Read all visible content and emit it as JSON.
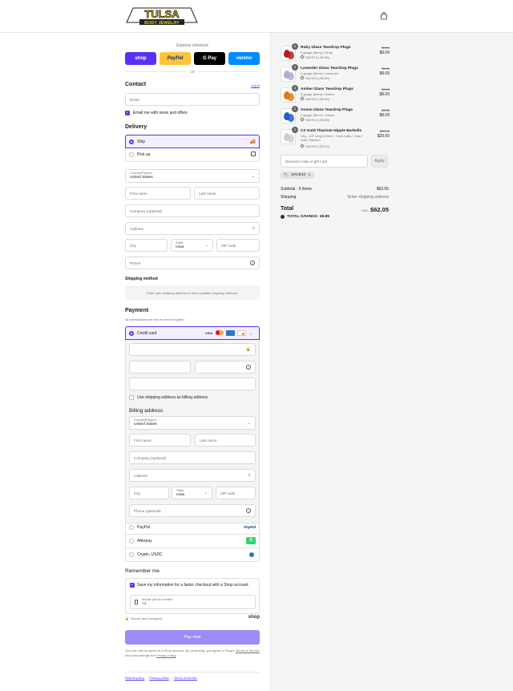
{
  "header": {
    "brand_main": "TULSA",
    "brand_sub": "BODY JEWELRY"
  },
  "express": {
    "title": "Express checkout",
    "buttons": [
      {
        "label": "shop",
        "color": "#5a31f4"
      },
      {
        "label": "PayPal",
        "color": "#ffc439"
      },
      {
        "label": "G Pay",
        "color": "#000000"
      },
      {
        "label": "venmo",
        "color": "#008cff"
      }
    ],
    "or": "OR"
  },
  "contact": {
    "heading": "Contact",
    "login": "Log in",
    "email_placeholder": "Email",
    "news_label": "Email me with news and offers"
  },
  "delivery": {
    "heading": "Delivery",
    "ship": "Ship",
    "pickup": "Pick up",
    "country_label": "Country/Region",
    "country_value": "United States",
    "first_name": "First name",
    "last_name": "Last name",
    "company": "Company (optional)",
    "address": "Address",
    "city": "City",
    "state_label": "State",
    "state_value": "Iowa",
    "zip": "ZIP code",
    "phone": "Phone"
  },
  "shipping_method": {
    "heading": "Shipping method",
    "note": "Enter your shipping address to view available shipping methods."
  },
  "payment": {
    "heading": "Payment",
    "subtitle": "All transactions are secure and encrypted.",
    "credit_card": "Credit card",
    "more_cards": "→",
    "use_shipping": "Use shipping address as billing address",
    "billing_heading": "Billing address",
    "billing": {
      "country_label": "Country/Region",
      "country_value": "United States",
      "first_name": "First name",
      "last_name": "Last name",
      "company": "Company (optional)",
      "address": "Address",
      "city": "City",
      "state_label": "State",
      "state_value": "Iowa",
      "zip": "ZIP code",
      "phone": "Phone (optional)"
    },
    "paypal": "PayPal",
    "paypal_logo": "PayPal",
    "afterpay": "Afterpay",
    "afterpay_logo": "$",
    "crypto": "Crypto, USDC"
  },
  "remember": {
    "heading": "Remember me",
    "save_label": "Save my information for a faster checkout with a Shop account",
    "mobile_label": "Mobile phone number",
    "mobile_value": "+1",
    "secure": "Secure and encrypted",
    "shop_logo": "shop"
  },
  "pay_now": "Pay now",
  "legal": {
    "text1": "Your info will be saved to a Shop account. By continuing, you agree to Shop's",
    "terms": "Terms of Service",
    "text2": "and acknowledge the",
    "privacy": "Privacy Policy",
    "text3": "."
  },
  "footer_links": [
    "Refund policy",
    "Privacy policy",
    "Terms of service"
  ],
  "cart": {
    "items": [
      {
        "title": "Ruby Glass Teardrop Plugs",
        "variant": "0 gauge (8mm) / Ruby",
        "discount": "SAVE10 (-$0.89)",
        "old_price": "$8.98",
        "price": "$8.09",
        "qty": "1",
        "color": "#b3201d"
      },
      {
        "title": "Lavender Glass Teardrop Plugs",
        "variant": "0 gauge (8mm) / Lavender",
        "discount": "SAVE10 (-$0.89)",
        "old_price": "$8.98",
        "price": "$8.09",
        "qty": "1",
        "color": "#b9a8d6"
      },
      {
        "title": "Amber Glass Teardrop Plugs",
        "variant": "0 gauge (8mm) / Amber",
        "discount": "SAVE10 (-$0.89)",
        "old_price": "$8.98",
        "price": "$8.09",
        "qty": "1",
        "color": "#e07a10"
      },
      {
        "title": "Ocean Glass Teardrop Plugs",
        "variant": "0 gauge (8mm) / Ocean",
        "discount": "SAVE10 (-$0.89)",
        "old_price": "$8.98",
        "price": "$8.09",
        "qty": "1",
        "color": "#1e64c8"
      },
      {
        "title": "CZ Gold Titanium Nipple Barbells",
        "variant": "14g - 1/2\" long (12mm) - 5mm balls / Clear / Gold Titanium",
        "discount": "SAVE10 (-$3.29)",
        "old_price": "$32.98",
        "price": "$29.69",
        "qty": "1",
        "color": "#cfcfcf"
      }
    ],
    "discount_placeholder": "Discount code or gift card",
    "apply": "Apply",
    "code": "SAVE10",
    "subtotal_label": "Subtotal · 5 items",
    "subtotal_value": "$62.05",
    "shipping_label": "Shipping",
    "shipping_value": "Enter shipping address",
    "total_label": "Total",
    "currency": "USD",
    "total_value": "$62.05",
    "savings_label": "TOTAL SAVINGS",
    "savings_value": "$6.85"
  }
}
